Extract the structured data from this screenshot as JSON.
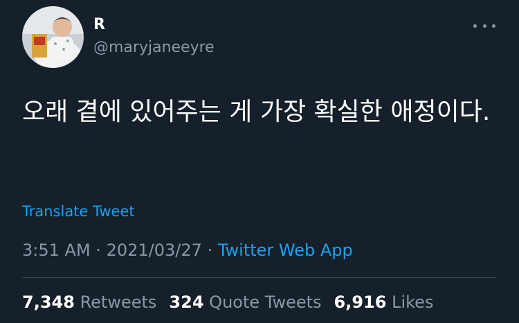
{
  "author": {
    "display_name": "R",
    "handle": "@maryjaneeyre",
    "avatar_icon": "profile-photo-child-with-book"
  },
  "more_icon": "more-horizontal-icon",
  "tweet": {
    "text": "오래 곁에 있어주는 게 가장 확실한 애정이다.",
    "translate_label": "Translate Tweet"
  },
  "meta": {
    "time": "3:51 AM",
    "separator": "·",
    "date": "2021/03/27",
    "source": "Twitter Web App"
  },
  "stats": {
    "retweets_count": "7,348",
    "retweets_label": "Retweets",
    "quote_count": "324",
    "quote_label": "Quote Tweets",
    "likes_count": "6,916",
    "likes_label": "Likes"
  },
  "colors": {
    "background": "#15202b",
    "text_primary": "#ffffff",
    "text_secondary": "#8899a6",
    "accent": "#1da1f2",
    "divider": "#38444d"
  }
}
